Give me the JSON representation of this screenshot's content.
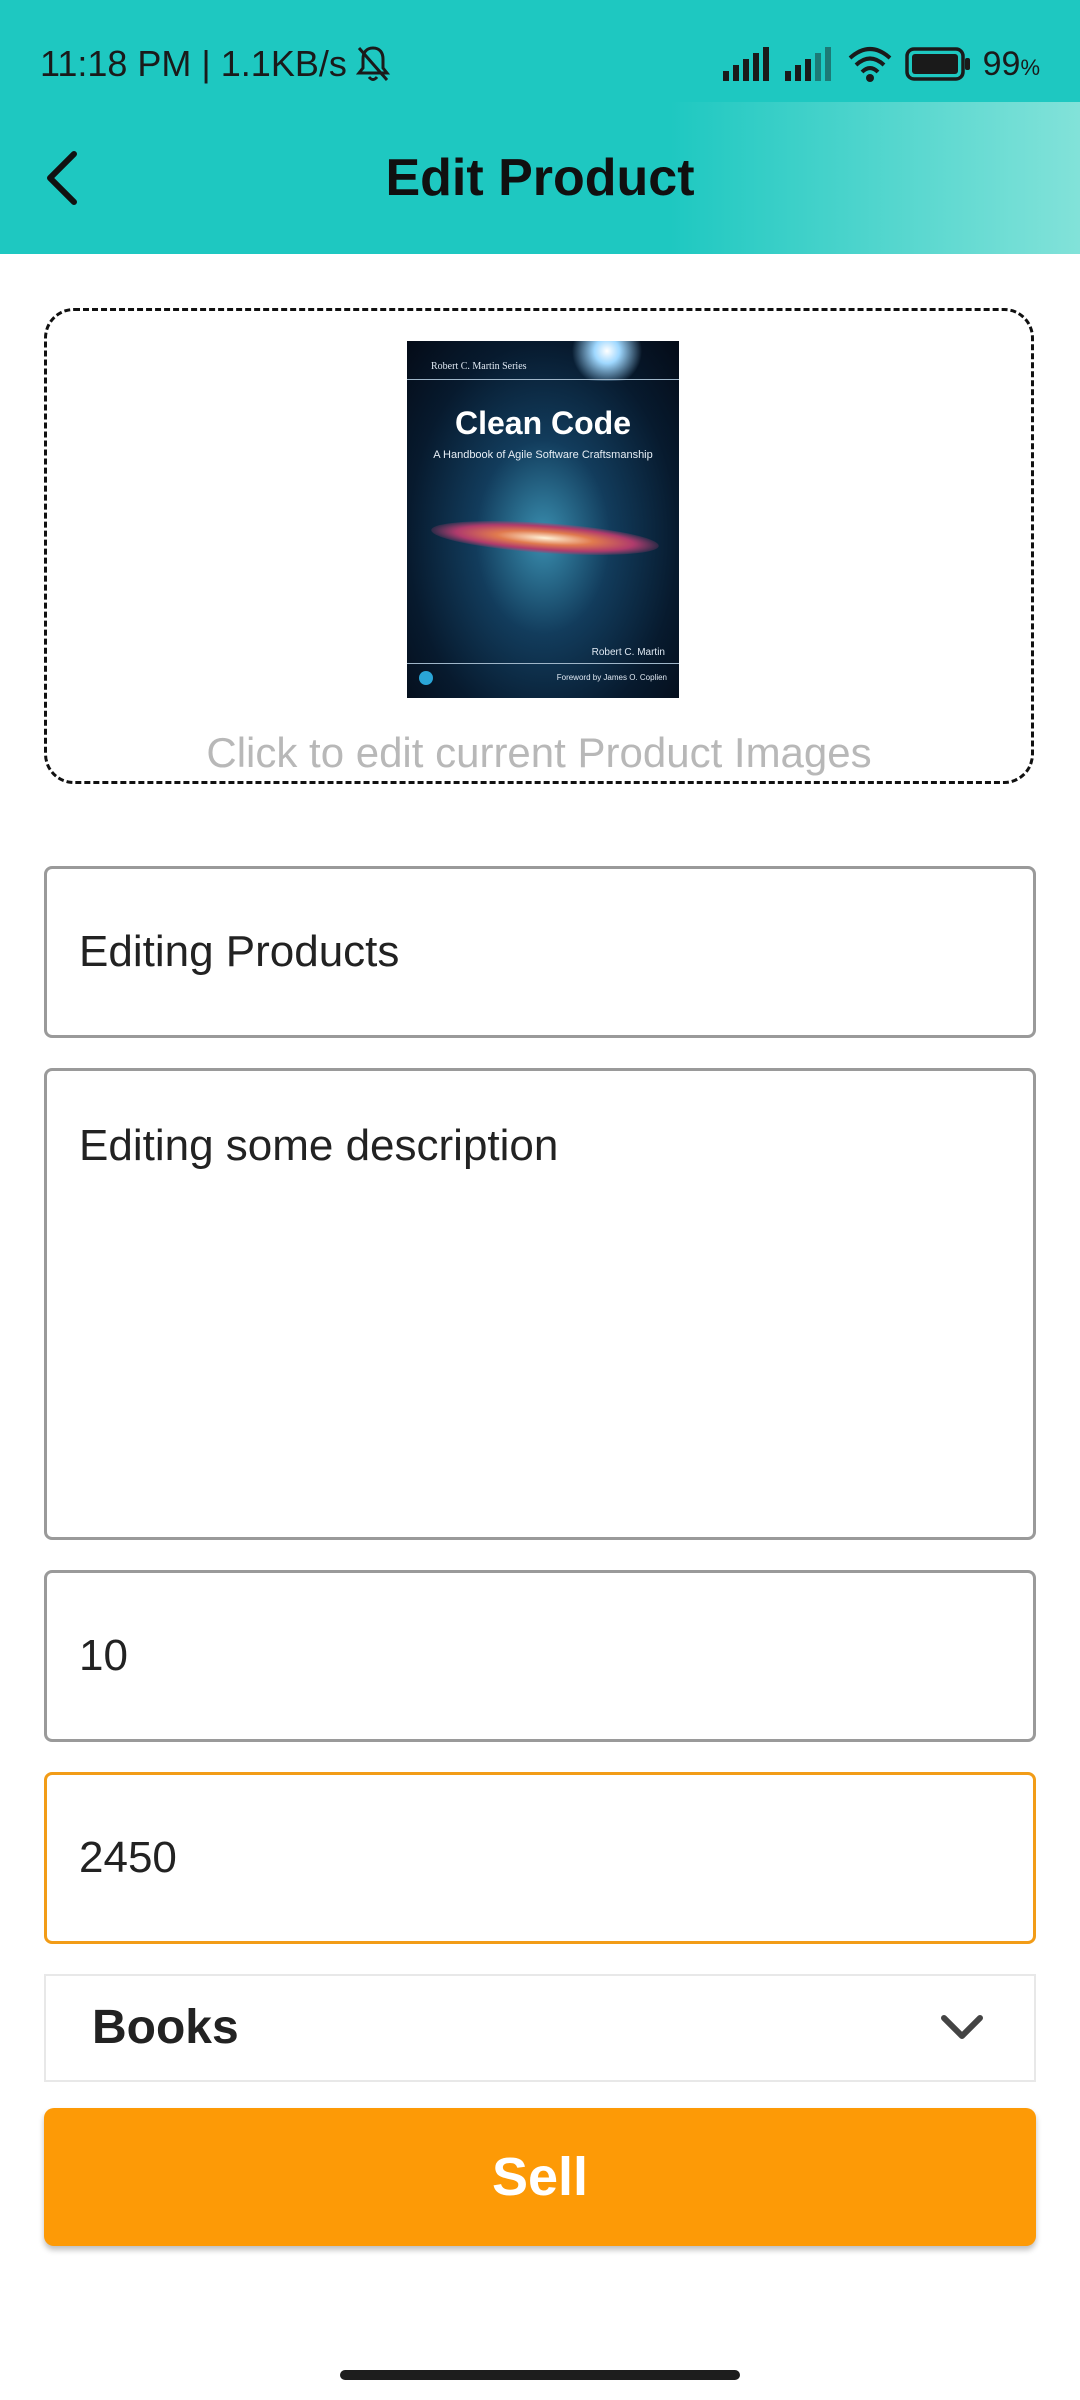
{
  "status_bar": {
    "time_speed": "11:18 PM | 1.1KB/s",
    "battery_percent": "99",
    "battery_unit": "%",
    "icons": [
      "bell-off-icon",
      "signal-icon",
      "signal-icon",
      "wifi-icon",
      "battery-icon"
    ],
    "color": "#1ec8c1"
  },
  "header": {
    "title": "Edit Product",
    "back_icon": "chevron-left-icon",
    "gradient": [
      "#1ec8c1",
      "#82e2d9"
    ]
  },
  "image_picker": {
    "hint": "Click to edit current Product Images",
    "cover": {
      "series": "Robert C. Martin Series",
      "title": "Clean Code",
      "subtitle": "A Handbook of Agile Software Craftsmanship",
      "author": "Robert C. Martin",
      "foreword": "Foreword by James O. Coplien"
    }
  },
  "form": {
    "name_value": "Editing Products",
    "description_value": "Editing some description",
    "quantity_value": "10",
    "price_value": "2450",
    "category_value": "Books",
    "focus_color": "#f29c17"
  },
  "actions": {
    "sell_label": "Sell",
    "sell_color": "#fd9a06"
  }
}
